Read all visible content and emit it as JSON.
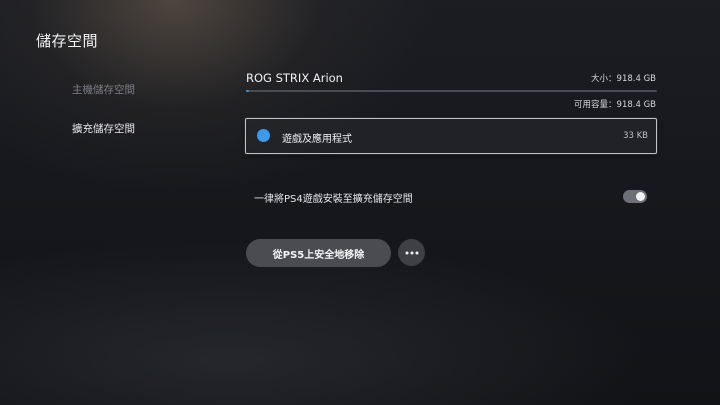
{
  "page": {
    "title": "儲存空間"
  },
  "sidebar": {
    "items": [
      {
        "label": "主機儲存空間",
        "active": false
      },
      {
        "label": "擴充儲存空間",
        "active": true
      }
    ]
  },
  "drive": {
    "name": "ROG STRIX Arion",
    "size_text": "大小：918.4 GB",
    "available_text": "可用容量：918.4 GB",
    "used_fraction": 0.007
  },
  "categories": [
    {
      "label": "遊戲及應用程式",
      "size": "33 KB",
      "color": "#3d9ae8"
    }
  ],
  "settings": {
    "install_ps4_label": "一律將PS4遊戲安裝至擴充儲存空間",
    "install_ps4_enabled": true
  },
  "actions": {
    "remove_label": "從PS5上安全地移除",
    "more_icon": "more-horizontal-icon"
  },
  "colors": {
    "accent": "#3a8ee6",
    "category_dot": "#3d9ae8"
  }
}
